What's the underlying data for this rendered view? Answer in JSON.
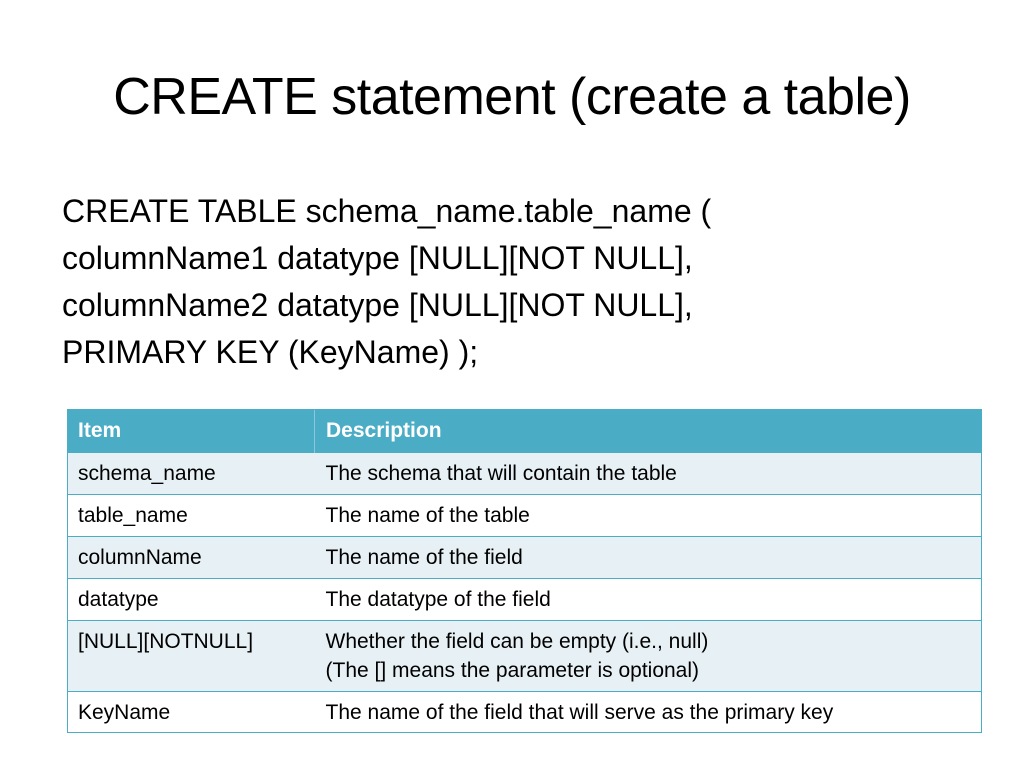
{
  "slide": {
    "title": "CREATE statement (create a table)"
  },
  "code": {
    "lines": [
      "CREATE TABLE schema_name.table_name (",
      "columnName1 datatype [NULL][NOT NULL],",
      "columnName2 datatype [NULL][NOT NULL],",
      "PRIMARY KEY (KeyName) );"
    ]
  },
  "table": {
    "headers": [
      "Item",
      "Description"
    ],
    "rows": [
      {
        "item": "schema_name",
        "desc": [
          "The schema that will contain the table"
        ]
      },
      {
        "item": "table_name",
        "desc": [
          "The name of the table"
        ]
      },
      {
        "item": "columnName",
        "desc": [
          "The name of the field"
        ]
      },
      {
        "item": "datatype",
        "desc": [
          "The datatype of the field"
        ]
      },
      {
        "item": "[NULL][NOTNULL]",
        "desc": [
          "Whether the field can be empty (i.e., null)",
          "(The [] means the parameter is optional)"
        ]
      },
      {
        "item": "KeyName",
        "desc": [
          "The name of the field that will serve as the primary key"
        ]
      }
    ],
    "header_color": "#4bacc6",
    "band_color": "#e7f0f4"
  }
}
